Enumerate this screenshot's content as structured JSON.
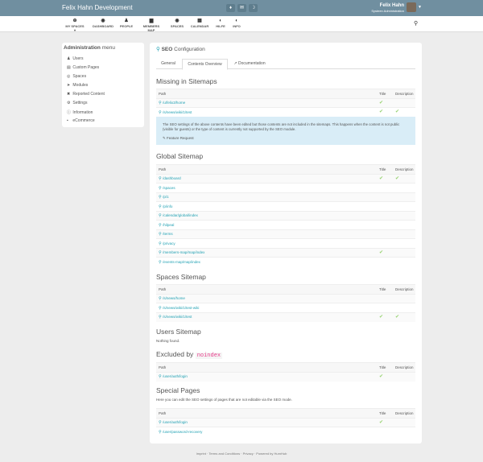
{
  "header": {
    "brand": "Felix Hahn Development",
    "user_name": "Felix Hahn",
    "user_role": "Systeen Administration"
  },
  "toolbar_icons": [
    "bell-icon",
    "envelope-icon",
    "moon-icon"
  ],
  "nav": [
    {
      "label": "MY SPACES ▾",
      "icon": "⊕"
    },
    {
      "label": "DASHBOARD",
      "icon": "◉"
    },
    {
      "label": "PEOPLE",
      "icon": "♟"
    },
    {
      "label": "MEMBERS MAP",
      "icon": "▆"
    },
    {
      "label": "SPACES",
      "icon": "◉"
    },
    {
      "label": "CALENDAR",
      "icon": "▦"
    },
    {
      "label": "HILFE",
      "icon": "◐"
    },
    {
      "label": "INFO",
      "icon": "◐"
    }
  ],
  "sidebar": {
    "title_bold": "Administration",
    "title_rest": "menu",
    "items": [
      {
        "label": "Users",
        "icon": "♟"
      },
      {
        "label": "Custom Pages",
        "icon": "▤"
      },
      {
        "label": "Spaces",
        "icon": "◎"
      },
      {
        "label": "Modules",
        "icon": "➤"
      },
      {
        "label": "Reported Content",
        "icon": "✖"
      },
      {
        "label": "Settings",
        "icon": "⚙"
      },
      {
        "label": "Information",
        "icon": "ⓘ"
      },
      {
        "label": "eCommerce",
        "icon": "▪"
      }
    ]
  },
  "panel": {
    "title_bold": "SEO",
    "title_rest": "Configuration",
    "tabs": [
      "General",
      "Contents Overview",
      "Documentation"
    ],
    "col_path": "Path",
    "col_title": "Title",
    "col_desc": "Description",
    "missing": {
      "heading": "Missing in Sitemaps",
      "rows": [
        {
          "path": "/u/felix3/home",
          "title": true,
          "desc": false
        },
        {
          "path": "/s/news/wiki/1/test",
          "title": true,
          "desc": true
        }
      ],
      "note": "The SEO settings of the above contents have been edited but those contents are not included in the sitemaps. This happens when the content is not public (visible for guests) or the type of content is currently not supported by the SEO module.",
      "feature_request": "Feature Request"
    },
    "global": {
      "heading": "Global Sitemap",
      "rows": [
        {
          "path": "/dashboard",
          "title": true,
          "desc": true
        },
        {
          "path": "/spaces",
          "title": false,
          "desc": false
        },
        {
          "path": "/p/1",
          "title": false,
          "desc": false
        },
        {
          "path": "/p/info",
          "title": false,
          "desc": false
        },
        {
          "path": "/calendar/global/index",
          "title": false,
          "desc": false
        },
        {
          "path": "/hilpeal",
          "title": false,
          "desc": false
        },
        {
          "path": "/terms",
          "title": false,
          "desc": false
        },
        {
          "path": "/privacy",
          "title": false,
          "desc": false
        },
        {
          "path": "/members-map/map/index",
          "title": true,
          "desc": false
        },
        {
          "path": "/events-map/map/index",
          "title": false,
          "desc": false
        }
      ]
    },
    "spaces": {
      "heading": "Spaces Sitemap",
      "rows": [
        {
          "path": "/s/news/home",
          "title": false,
          "desc": false
        },
        {
          "path": "/s/news/wiki/1/test-wiki",
          "title": false,
          "desc": false
        },
        {
          "path": "/s/news/wiki/1/test",
          "title": true,
          "desc": true
        }
      ]
    },
    "users": {
      "heading": "Users Sitemap",
      "empty": "Nothing found."
    },
    "excluded": {
      "heading": "Excluded by",
      "code": "noindex",
      "rows": [
        {
          "path": "/user/auth/login",
          "title": true,
          "desc": false
        }
      ]
    },
    "special": {
      "heading": "Special Pages",
      "intro": "Here you can edit the SEO settings of pages that are not editable via the SEO mode.",
      "rows": [
        {
          "path": "/user/auth/login",
          "title": true,
          "desc": false
        },
        {
          "path": "/user/password-recovery",
          "title": false,
          "desc": false
        }
      ]
    }
  },
  "footer": "Imprint  ·  Terms and Conditions  ·  Privacy  ·  Powered by HumHub",
  "colors": {
    "topbar": "#708fa0",
    "link": "#21a1b3",
    "check": "#97d271",
    "info_bg": "#d9edf7"
  }
}
